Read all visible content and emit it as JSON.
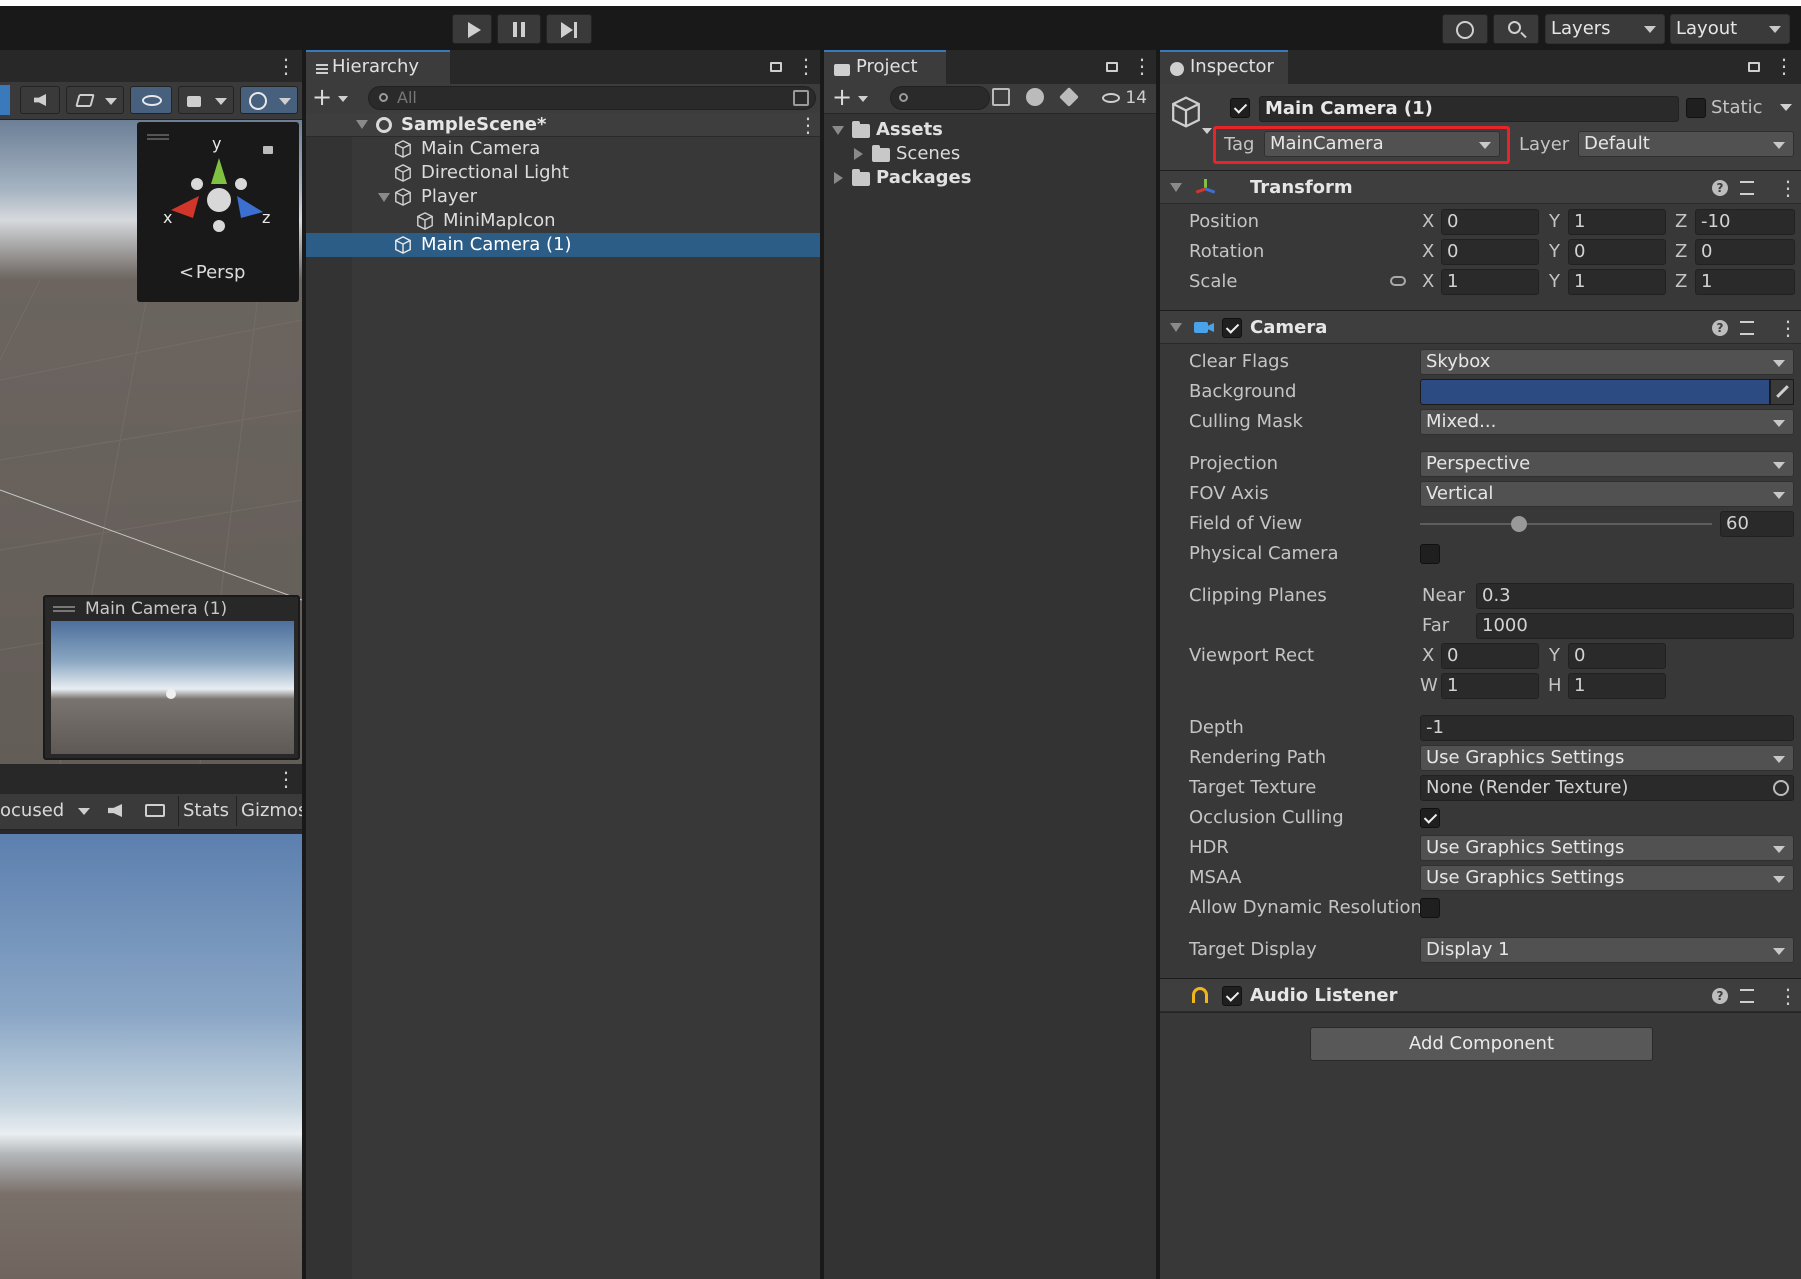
{
  "toolbar": {
    "layers_label": "Layers",
    "layout_label": "Layout"
  },
  "scene_view": {
    "gizmo": {
      "axis_y": "y",
      "axis_x": "x",
      "axis_z": "z",
      "persp_label": "Persp"
    },
    "camera_preview_title": "Main Camera (1)"
  },
  "game_view": {
    "focused_label": "ocused",
    "stats_label": "Stats",
    "gizmos_label": "Gizmos"
  },
  "hierarchy": {
    "tab_label": "Hierarchy",
    "search_placeholder": "All",
    "scene_name": "SampleScene*",
    "items": [
      {
        "label": "Main Camera"
      },
      {
        "label": "Directional Light"
      },
      {
        "label": "Player"
      },
      {
        "label": "MiniMapIcon"
      },
      {
        "label": "Main Camera (1)"
      }
    ]
  },
  "project": {
    "tab_label": "Project",
    "hidden_count": "14",
    "tree": [
      {
        "label": "Assets"
      },
      {
        "label": "Scenes"
      },
      {
        "label": "Packages"
      }
    ]
  },
  "inspector": {
    "tab_label": "Inspector",
    "object_name": "Main Camera (1)",
    "static_label": "Static",
    "tag_label": "Tag",
    "tag_value": "MainCamera",
    "layer_label": "Layer",
    "layer_value": "Default",
    "transform": {
      "title": "Transform",
      "position_label": "Position",
      "rotation_label": "Rotation",
      "scale_label": "Scale",
      "position": {
        "x": "0",
        "y": "1",
        "z": "-10"
      },
      "rotation": {
        "x": "0",
        "y": "0",
        "z": "0"
      },
      "scale": {
        "x": "1",
        "y": "1",
        "z": "1"
      },
      "axis_x": "X",
      "axis_y": "Y",
      "axis_z": "Z"
    },
    "camera": {
      "title": "Camera",
      "clear_flags_label": "Clear Flags",
      "clear_flags": "Skybox",
      "background_label": "Background",
      "background_color": "#2c4b82",
      "culling_mask_label": "Culling Mask",
      "culling_mask": "Mixed...",
      "projection_label": "Projection",
      "projection": "Perspective",
      "fov_axis_label": "FOV Axis",
      "fov_axis": "Vertical",
      "fov_label": "Field of View",
      "fov": "60",
      "fov_fraction": 0.34,
      "physical_label": "Physical Camera",
      "clipping_label": "Clipping Planes",
      "near_label": "Near",
      "near": "0.3",
      "far_label": "Far",
      "far": "1000",
      "viewport_label": "Viewport Rect",
      "vp_x_label": "X",
      "vp_x": "0",
      "vp_y_label": "Y",
      "vp_y": "0",
      "vp_w_label": "W",
      "vp_w": "1",
      "vp_h_label": "H",
      "vp_h": "1",
      "depth_label": "Depth",
      "depth": "-1",
      "rendering_path_label": "Rendering Path",
      "rendering_path": "Use Graphics Settings",
      "target_texture_label": "Target Texture",
      "target_texture": "None (Render Texture)",
      "occlusion_label": "Occlusion Culling",
      "hdr_label": "HDR",
      "hdr": "Use Graphics Settings",
      "msaa_label": "MSAA",
      "msaa": "Use Graphics Settings",
      "dynres_label": "Allow Dynamic Resolution",
      "target_display_label": "Target Display",
      "target_display": "Display 1"
    },
    "audio_listener": {
      "title": "Audio Listener"
    },
    "add_component_label": "Add Component"
  },
  "colors": {
    "highlight_box": "#e8232a",
    "selection": "#2c5d87",
    "accent_tab": "#3a79bb"
  }
}
